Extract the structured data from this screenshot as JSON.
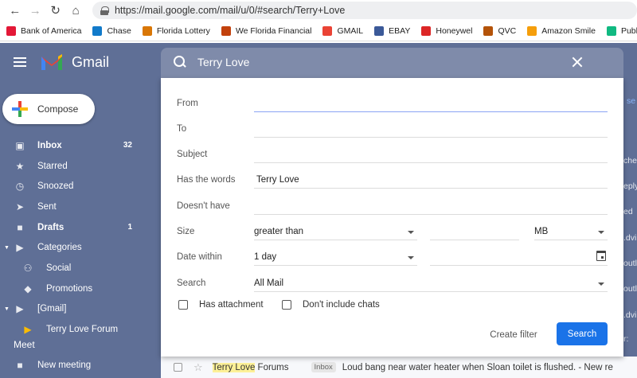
{
  "browser": {
    "url": "https://mail.google.com/mail/u/0/#search/Terry+Love",
    "bookmarks": [
      {
        "label": "Bank of America",
        "icon": "bank-of-america-icon",
        "color": "#e31837"
      },
      {
        "label": "Chase",
        "icon": "chase-icon",
        "color": "#117aca"
      },
      {
        "label": "Florida Lottery",
        "icon": "florida-lottery-icon",
        "color": "#d97706"
      },
      {
        "label": "We Florida Financial",
        "icon": "we-florida-icon",
        "color": "#c2410c"
      },
      {
        "label": "GMAIL",
        "icon": "gmail-icon",
        "color": "#ea4335"
      },
      {
        "label": "EBAY",
        "icon": "ebay-icon",
        "color": "#3b5998"
      },
      {
        "label": "Honeywel",
        "icon": "honeywell-icon",
        "color": "#dc2626"
      },
      {
        "label": "QVC",
        "icon": "qvc-icon",
        "color": "#b45309"
      },
      {
        "label": "Amazon Smile",
        "icon": "amazon-smile-icon",
        "color": "#f59e0b"
      },
      {
        "label": "Publix P",
        "icon": "publix-icon",
        "color": "#10b981"
      }
    ]
  },
  "gmail": {
    "brand": "Gmail",
    "compose_label": "Compose",
    "sidebar": [
      {
        "label": "Inbox",
        "count": "32",
        "icon": "inbox-icon",
        "bold": true
      },
      {
        "label": "Starred",
        "count": "",
        "icon": "star-icon",
        "bold": false
      },
      {
        "label": "Snoozed",
        "count": "",
        "icon": "clock-icon",
        "bold": false
      },
      {
        "label": "Sent",
        "count": "",
        "icon": "send-icon",
        "bold": false
      },
      {
        "label": "Drafts",
        "count": "1",
        "icon": "draft-icon",
        "bold": true
      },
      {
        "label": "Categories",
        "count": "",
        "icon": "label-icon",
        "bold": false
      },
      {
        "label": "Social",
        "count": "",
        "icon": "people-icon",
        "bold": false
      },
      {
        "label": "Promotions",
        "count": "",
        "icon": "tag-icon",
        "bold": false
      },
      {
        "label": "[Gmail]",
        "count": "",
        "icon": "label-icon",
        "bold": false
      },
      {
        "label": "Terry Love Forum",
        "count": "",
        "icon": "label-icon",
        "bold": false
      }
    ],
    "meet_title": "Meet",
    "meet_item": "New meeting",
    "peeks": [
      "chec",
      "eply",
      "ed",
      ".dvi",
      "outle",
      "outle",
      ".dvi",
      "r:"
    ],
    "peek_link": "se",
    "bottom_row": {
      "sender_highlight": "Terry Love",
      "sender_rest": " Forums",
      "badge": "Inbox",
      "subject": "Loud bang near water heater when Sloan toilet is flushed. - New re"
    }
  },
  "search": {
    "query": "Terry Love",
    "labels": {
      "from": "From",
      "to": "To",
      "subject": "Subject",
      "has_words": "Has the words",
      "doesnt_have": "Doesn't have",
      "size": "Size",
      "date_within": "Date within",
      "search_in": "Search"
    },
    "values": {
      "from": "",
      "to": "",
      "subject": "",
      "has_words": "Terry Love",
      "doesnt_have": "",
      "size_operator": "greater than",
      "size_value": "",
      "size_unit": "MB",
      "date_within": "1 day",
      "date_value": "",
      "search_in": "All Mail"
    },
    "has_attachment_label": "Has attachment",
    "dont_include_chats_label": "Don't include chats",
    "create_filter_label": "Create filter",
    "search_button_label": "Search",
    "accent": "#1a73e8"
  }
}
